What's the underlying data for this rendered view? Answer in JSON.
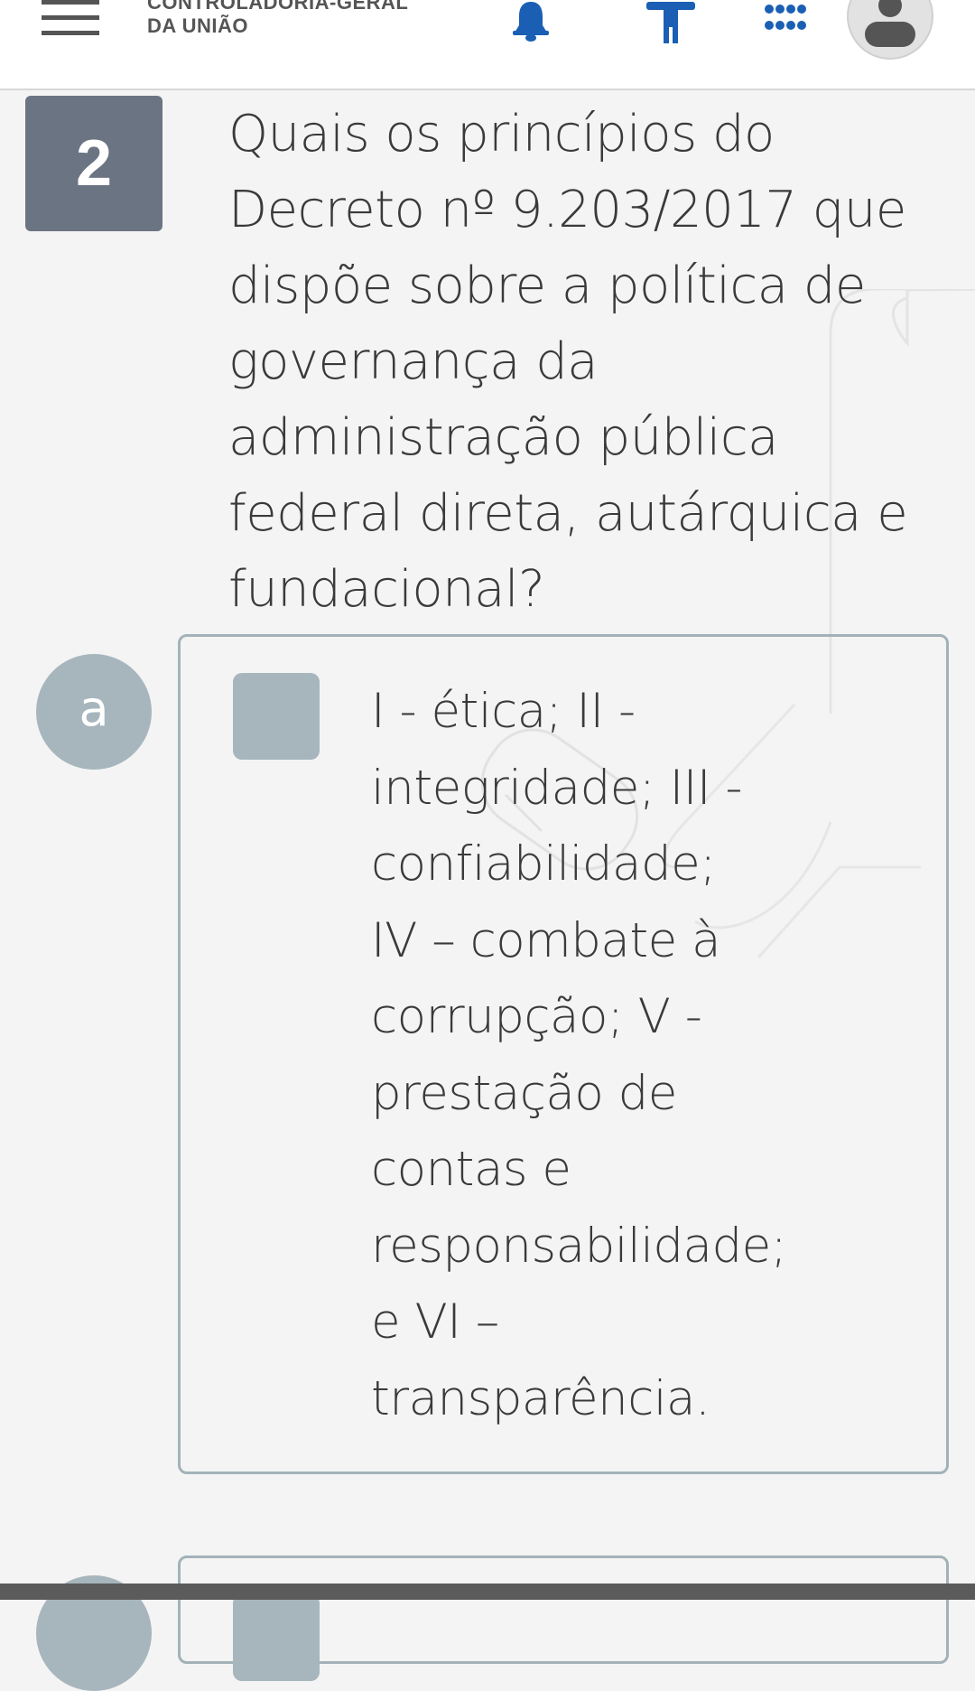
{
  "header": {
    "menu_icon": "hamburger-menu-icon",
    "brand_line1": "CONTROLADORIA-GERAL",
    "brand_line2": "DA UNIÃO",
    "icons": [
      "bell-icon",
      "accessibility-icon",
      "apps-grid-icon",
      "user-avatar-icon"
    ]
  },
  "question": {
    "number": "2",
    "text": "Quais os princípios do Decreto nº 9.203/2017 que dispõe sobre a política de governança da administração pública federal direta, autárquica e fundacional?"
  },
  "options": [
    {
      "letter": "a",
      "lines": [
        "I - ética; II -",
        "integridade; III -",
        "confiabilidade;",
        "IV – combate à",
        "corrupção; V -",
        "prestação de",
        "contas e",
        "responsabilidade;",
        "e VI –",
        "transparência."
      ]
    }
  ],
  "colors": {
    "header_bg": "#ffffff",
    "page_bg": "#f4f4f4",
    "question_badge": "#6b7482",
    "option_accent": "#a7b6bd",
    "accent_blue": "#1a5fb4"
  }
}
